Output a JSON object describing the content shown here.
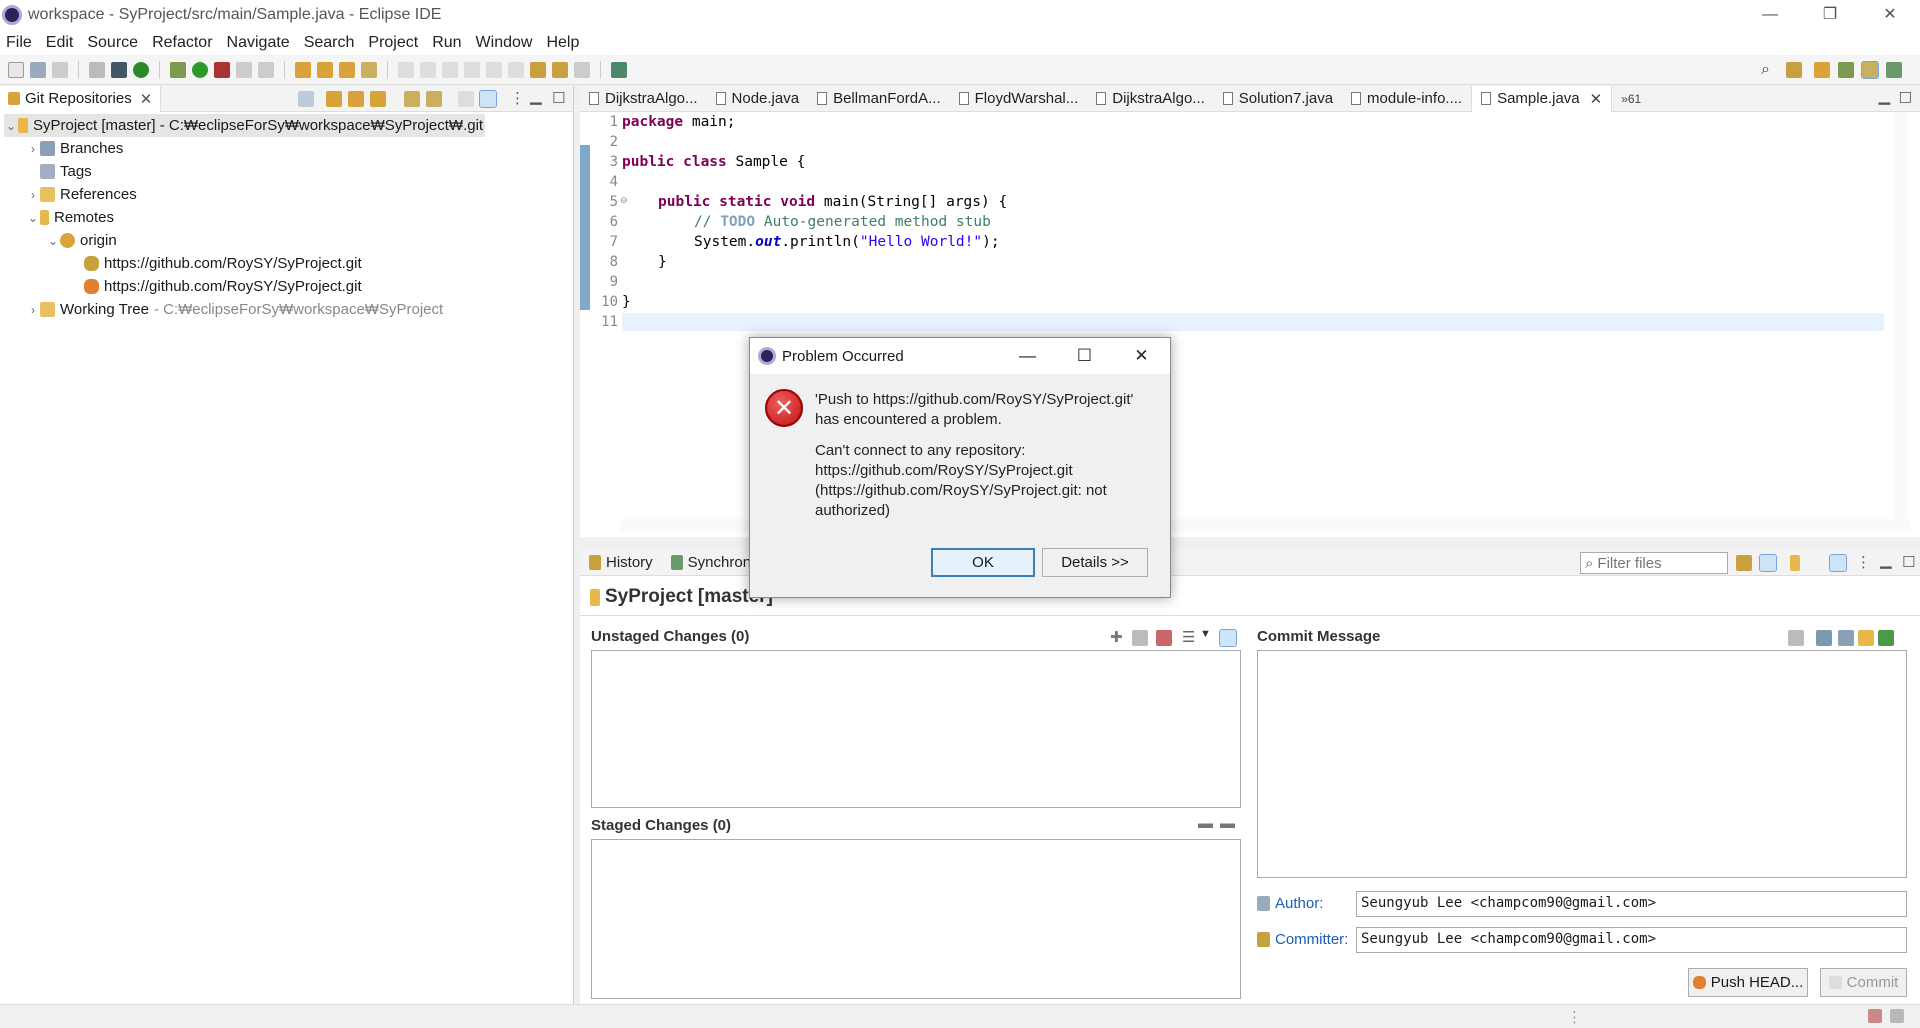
{
  "window": {
    "title": "workspace - SyProject/src/main/Sample.java - Eclipse IDE",
    "controls": [
      "—",
      "❐",
      "✕"
    ]
  },
  "menu": [
    "File",
    "Edit",
    "Source",
    "Refactor",
    "Navigate",
    "Search",
    "Project",
    "Run",
    "Window",
    "Help"
  ],
  "git_view": {
    "tab_label": "Git Repositories",
    "tree": [
      {
        "label": "SyProject [master] - C:₩eclipseForSy₩workspace₩SyProject₩.git",
        "detail": ""
      },
      {
        "label": "Branches",
        "detail": ""
      },
      {
        "label": "Tags",
        "detail": ""
      },
      {
        "label": "References",
        "detail": ""
      },
      {
        "label": "Remotes",
        "detail": ""
      },
      {
        "label": "origin",
        "detail": ""
      },
      {
        "label": "https://github.com/RoySY/SyProject.git",
        "detail": ""
      },
      {
        "label": "https://github.com/RoySY/SyProject.git",
        "detail": ""
      },
      {
        "label": "Working Tree",
        "detail": "- C:₩eclipseForSy₩workspace₩SyProject"
      }
    ]
  },
  "editor": {
    "tabs": [
      "DijkstraAlgo...",
      "Node.java",
      "BellmanFordA...",
      "FloydWarshal...",
      "DijkstraAlgo...",
      "Solution7.java",
      "module-info....",
      "Sample.java"
    ],
    "overflow_label": "»61",
    "active_tab": "Sample.java",
    "line_numbers": [
      "1",
      "2",
      "3",
      "4",
      "5",
      "6",
      "7",
      "8",
      "9",
      "10",
      "11"
    ],
    "code": {
      "l1_kw": "package",
      "l1_rest": " main;",
      "l3_kw": "public class",
      "l3_rest": " Sample {",
      "l5_kw": "public static void",
      "l5_rest": " main(String[] args) {",
      "l6_cm1": "// ",
      "l6_todo": "TODO",
      "l6_cm2": " Auto-generated method stub",
      "l7_a": "System.",
      "l7_fld": "out",
      "l7_b": ".println(",
      "l7_str": "\"Hello World!\"",
      "l7_c": ");",
      "l8": "}",
      "l10": "}"
    }
  },
  "bottom": {
    "tabs": [
      "History",
      "Synchroniz"
    ],
    "filter_placeholder": "Filter files",
    "repo_title": "SyProject [master]",
    "unstaged_title": "Unstaged Changes (0)",
    "staged_title": "Staged Changes (0)",
    "commit_title": "Commit Message",
    "author_label": "Author:",
    "author_value": "Seungyub Lee <champcom90@gmail.com>",
    "committer_label": "Committer:",
    "committer_value": "Seungyub Lee <champcom90@gmail.com>",
    "push_label": "Push HEAD...",
    "commit_label": "Commit"
  },
  "dialog": {
    "title": "Problem Occurred",
    "line1": "'Push to https://github.com/RoySY/SyProject.git'",
    "line2": "has encountered a problem.",
    "detail1": "Can't connect to any repository:",
    "detail2": "https://github.com/RoySY/SyProject.git",
    "detail3": "(https://github.com/RoySY/SyProject.git: not",
    "detail4": "authorized)",
    "ok_label": "OK",
    "details_label": "Details >>",
    "controls": [
      "—",
      "☐",
      "✕"
    ]
  },
  "colors": {
    "accent": "#1a5fb4",
    "error": "#c01010",
    "selection": "#cce8ff",
    "change_bar": "#7fa8c9"
  }
}
